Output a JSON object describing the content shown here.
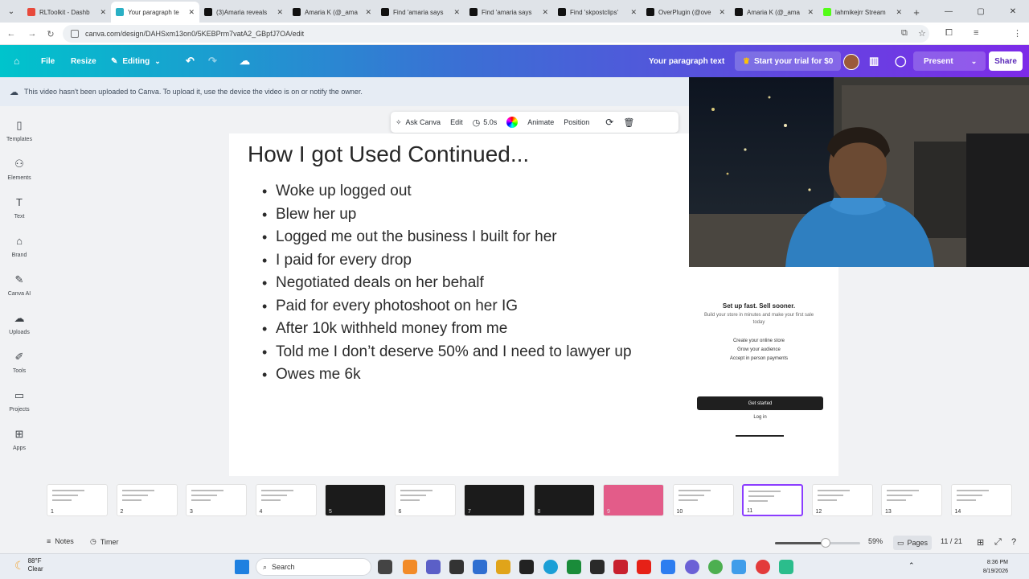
{
  "browser": {
    "tabs": [
      {
        "title": "RLToolkit - Dashb",
        "color": "#e84a3c"
      },
      {
        "title": "Your paragraph te",
        "color": "#2ab0c5",
        "active": true
      },
      {
        "title": "(3)Amaria reveals",
        "color": "#111111"
      },
      {
        "title": "Amaria K (@_ama",
        "color": "#111111"
      },
      {
        "title": "Find 'amaria says",
        "color": "#111111"
      },
      {
        "title": "Find 'amaria says",
        "color": "#111111"
      },
      {
        "title": "Find 'skpostclips'",
        "color": "#111111"
      },
      {
        "title": "OverPlugin (@ove",
        "color": "#111111"
      },
      {
        "title": "Amaria K (@_ama",
        "color": "#111111"
      },
      {
        "title": "lahmikejrr Stream",
        "color": "#53fc18"
      }
    ],
    "url": "canva.com/design/DAHSxm13on0/5KEBPrm7vatA2_GBpfJ7OA/edit"
  },
  "header": {
    "file_label": "File",
    "resize_label": "Resize",
    "editing_label": "Editing",
    "doc_title": "Your paragraph text",
    "trial_label": "Start your trial for $0",
    "present_label": "Present",
    "share_label": "Share"
  },
  "sidebar": {
    "items": [
      {
        "label": "Templates",
        "icon": "▯"
      },
      {
        "label": "Elements",
        "icon": "⚇"
      },
      {
        "label": "Text",
        "icon": "T"
      },
      {
        "label": "Brand",
        "icon": "⌂"
      },
      {
        "label": "Canva AI",
        "icon": "✎"
      },
      {
        "label": "Uploads",
        "icon": "☁"
      },
      {
        "label": "Tools",
        "icon": "✐"
      },
      {
        "label": "Projects",
        "icon": "▭"
      },
      {
        "label": "Apps",
        "icon": "⊞"
      }
    ]
  },
  "notice": {
    "text": "This video hasn't been uploaded to Canva. To upload it, use the device the video is on or notify the owner."
  },
  "context_toolbar": {
    "ask_canva": "Ask Canva",
    "edit": "Edit",
    "duration": "5.0s",
    "animate": "Animate",
    "position": "Position"
  },
  "slide": {
    "title": "How I got Used Continued...",
    "bullets": [
      "Woke up logged out",
      "Blew her up",
      "Logged me out the business I built for her",
      "I paid for every drop",
      "Negotiated deals on her behalf",
      "Paid for every photoshoot on her IG",
      "After 10k withheld money from me",
      "Told me I don’t deserve 50% and I need to lawyer up",
      "Owes me 6k"
    ]
  },
  "store_preview": {
    "heading": "Set up fast. Sell sooner.",
    "subtext": "Build your store in minutes and make your first sale today",
    "links": [
      "Create your online store",
      "Grow your audience",
      "Accept in person payments"
    ],
    "get_started": "Get started",
    "log_in": "Log in"
  },
  "filmstrip": {
    "pages": [
      "1",
      "2",
      "3",
      "4",
      "5",
      "6",
      "7",
      "8",
      "9",
      "10",
      "11",
      "12",
      "13",
      "14"
    ],
    "selected": "11"
  },
  "status": {
    "notes_label": "Notes",
    "timer_label": "Timer",
    "zoom": "59%",
    "zoom_fraction": 0.59,
    "pages_label": "Pages",
    "page_counter": "11 / 21"
  },
  "taskbar": {
    "temperature": "88°F",
    "condition": "Clear",
    "search_label": "Search",
    "time": "8:36 PM",
    "date": "8/19/2026"
  }
}
